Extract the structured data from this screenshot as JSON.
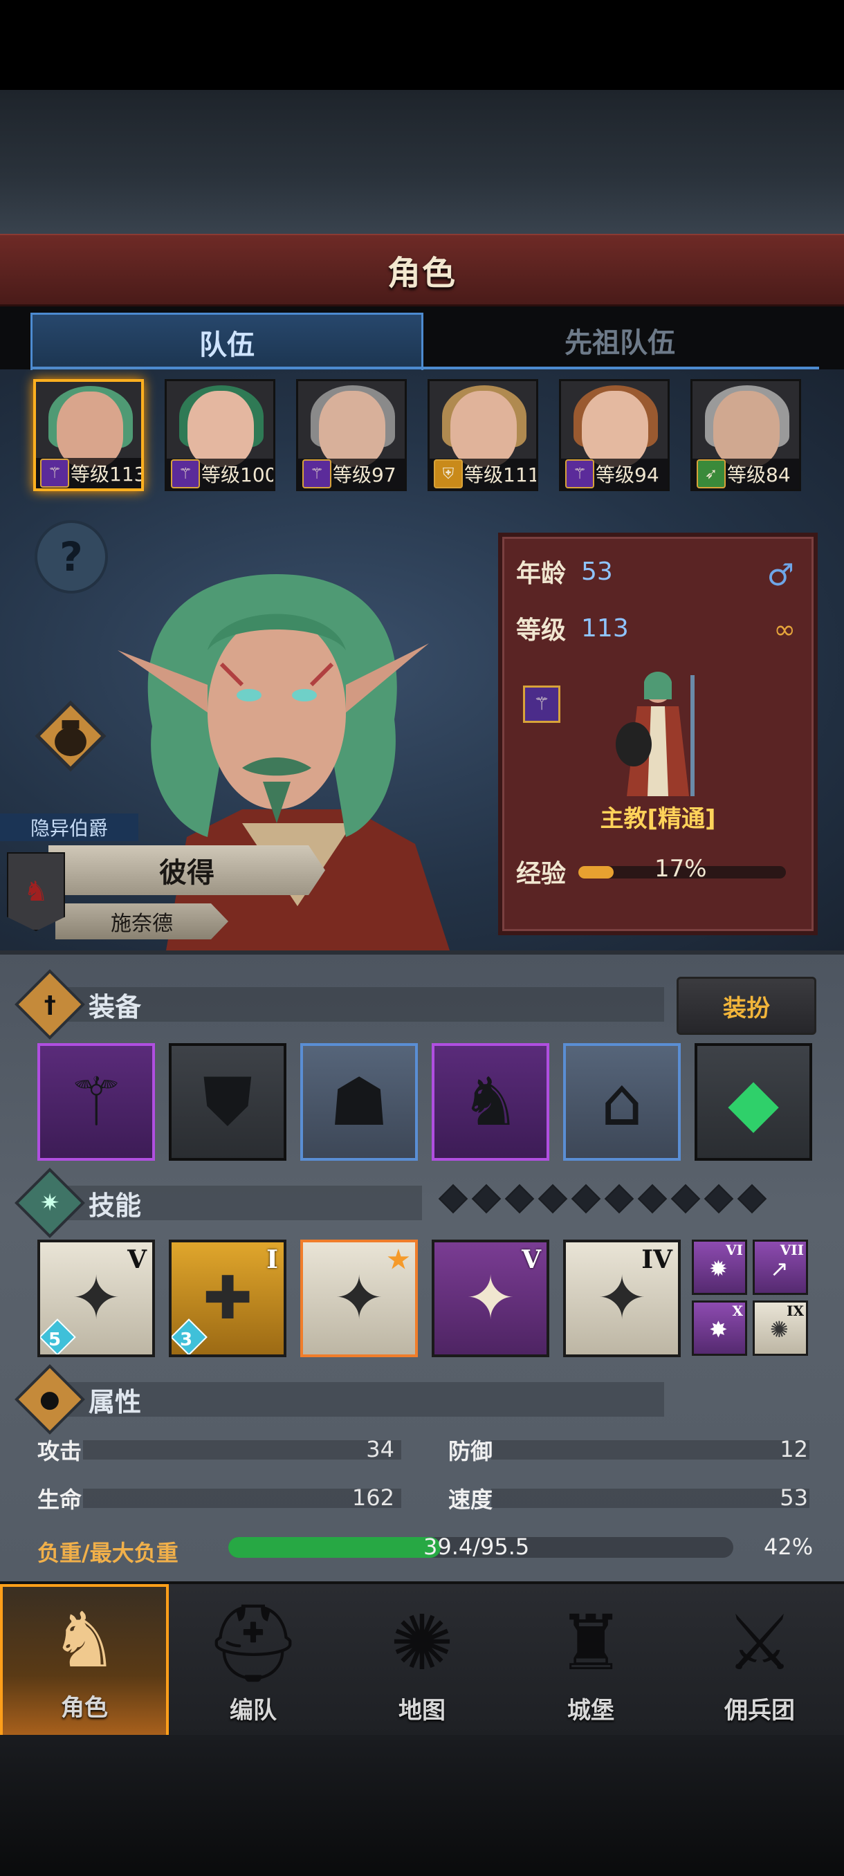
{
  "title": "角色",
  "tabs": {
    "party": "队伍",
    "ancestor_party": "先祖队伍"
  },
  "party_members": [
    {
      "level": "等级113",
      "class_icon": "staff",
      "hair": "#4f9a74",
      "skin": "#d9a58c"
    },
    {
      "level": "等级100",
      "class_icon": "staff",
      "hair": "#2f7a55",
      "skin": "#e4b7a0"
    },
    {
      "level": "等级97",
      "class_icon": "staff",
      "hair": "#8a8a8a",
      "skin": "#d8b09a"
    },
    {
      "level": "等级111",
      "class_icon": "shield",
      "hair": "#b08a50",
      "skin": "#e0b39a"
    },
    {
      "level": "等级94",
      "class_icon": "staff",
      "hair": "#9a5a30",
      "skin": "#e4b9a0"
    },
    {
      "level": "等级84",
      "class_icon": "bow",
      "hair": "#9a9a9a",
      "skin": "#d0a890"
    }
  ],
  "character": {
    "title_tag": "隐异伯爵",
    "name": "彼得",
    "surname": "施奈德",
    "age_label": "年龄",
    "age": "53",
    "level_label": "等级",
    "level": "113",
    "class_name": "主教[精通]",
    "exp_label": "经验",
    "exp_percent_text": "17%",
    "exp_fraction": 0.17
  },
  "equipment": {
    "title": "装备",
    "dress_button": "装扮",
    "slots": [
      {
        "name": "staff",
        "rarity": "purple"
      },
      {
        "name": "shield",
        "rarity": "dark"
      },
      {
        "name": "hood",
        "rarity": "blue"
      },
      {
        "name": "robe",
        "rarity": "purple"
      },
      {
        "name": "boots",
        "rarity": "blue"
      },
      {
        "name": "gem-amulet",
        "rarity": "dark"
      }
    ]
  },
  "skills": {
    "title": "技能",
    "slots": [
      {
        "roman": "V",
        "gem": "5",
        "style": "light"
      },
      {
        "roman": "I",
        "gem": "3",
        "style": "gold"
      },
      {
        "roman": "★",
        "gem": "",
        "style": "light-orange"
      },
      {
        "roman": "V",
        "gem": "",
        "style": "purple"
      },
      {
        "roman": "IV",
        "gem": "",
        "style": "light"
      }
    ],
    "mini": [
      {
        "roman": "VI",
        "style": "purple"
      },
      {
        "roman": "VII",
        "style": "purple"
      },
      {
        "roman": "X",
        "style": "purple"
      },
      {
        "roman": "IX",
        "style": "light"
      }
    ]
  },
  "attributes": {
    "title": "属性",
    "attack_label": "攻击",
    "attack": "34",
    "defense_label": "防御",
    "defense": "12",
    "hp_label": "生命",
    "hp": "162",
    "speed_label": "速度",
    "speed": "53",
    "load_label": "负重/最大负重",
    "load_value": "39.4/95.5",
    "load_percent_text": "42%",
    "load_fraction": 0.42
  },
  "nav": [
    {
      "label": "角色",
      "icon": "knight-icon"
    },
    {
      "label": "编队",
      "icon": "helmet-icon"
    },
    {
      "label": "地图",
      "icon": "compass-icon"
    },
    {
      "label": "城堡",
      "icon": "castle-icon"
    },
    {
      "label": "佣兵团",
      "icon": "mercenary-icon"
    }
  ],
  "colors": {
    "accent": "#ffb01f",
    "title_bar": "#6e2a26",
    "tab_active": "#4d8bd0",
    "load_fill": "#27a844"
  }
}
